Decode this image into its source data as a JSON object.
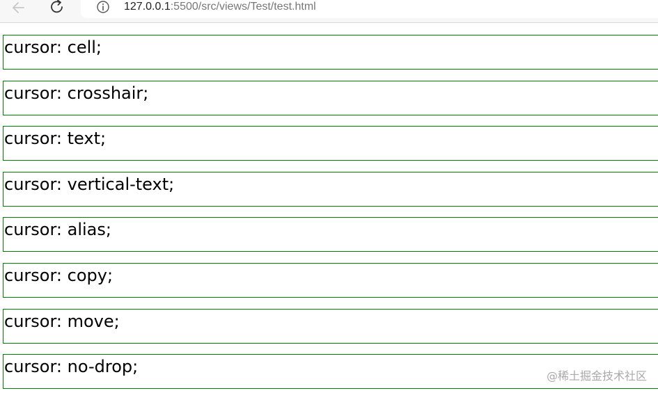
{
  "browser": {
    "url_host": "127.0.0.1",
    "url_path": ":5500/src/views/Test/test.html",
    "back_icon": "arrow-left-icon",
    "refresh_icon": "refresh-icon",
    "info_icon": "info-icon"
  },
  "boxes": [
    {
      "label": "cursor: cell;",
      "cursor": "cell"
    },
    {
      "label": "cursor: crosshair;",
      "cursor": "crosshair"
    },
    {
      "label": "cursor: text;",
      "cursor": "text"
    },
    {
      "label": "cursor: vertical-text;",
      "cursor": "vertical-text"
    },
    {
      "label": "cursor: alias;",
      "cursor": "alias"
    },
    {
      "label": "cursor: copy;",
      "cursor": "copy"
    },
    {
      "label": "cursor: move;",
      "cursor": "move"
    },
    {
      "label": "cursor: no-drop;",
      "cursor": "no-drop"
    }
  ],
  "watermark": "@稀土掘金技术社区",
  "colors": {
    "box_border": "#008000",
    "url_host": "#202124",
    "url_path": "#777777",
    "watermark": "#a9a9a9"
  }
}
